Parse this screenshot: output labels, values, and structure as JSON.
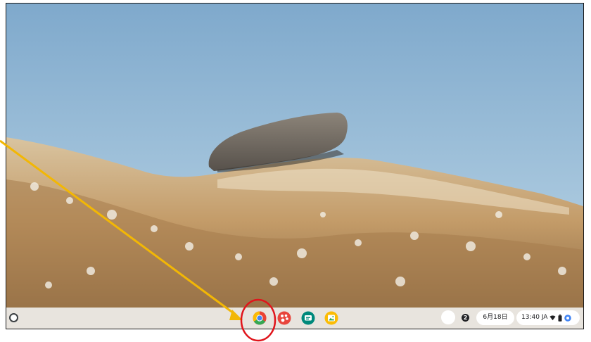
{
  "shelf": {
    "launcher_icon": "launcher-circle-icon",
    "pinned_apps": [
      {
        "name": "Chrome",
        "icon": "chrome-icon"
      },
      {
        "name": "Color palette",
        "icon": "palette-icon"
      },
      {
        "name": "Messages",
        "icon": "chat-icon"
      },
      {
        "name": "Gallery",
        "icon": "gallery-icon"
      }
    ],
    "tray": {
      "notification_count": "2",
      "date": "6月18日",
      "time": "13:40",
      "ime": "JA",
      "icons": [
        "wifi-icon",
        "battery-icon",
        "account-icon"
      ]
    }
  },
  "colors": {
    "shelf_bg": "#e8e4de",
    "sky": "#9fc3dc",
    "hill": "#c8a87a",
    "annotation_arrow": "#f2b705",
    "annotation_circle": "#e0141b"
  }
}
